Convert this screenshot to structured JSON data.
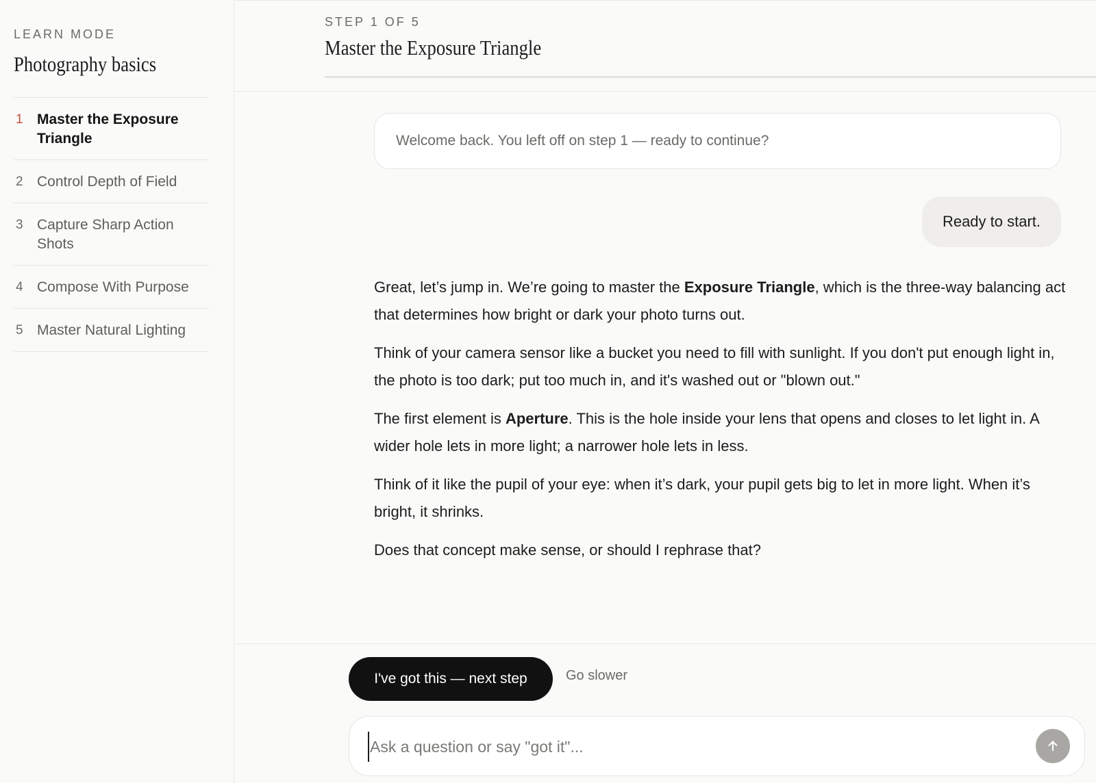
{
  "sidebar": {
    "mode_label": "LEARN MODE",
    "course_title": "Photography basics",
    "steps": [
      {
        "num": "1",
        "label": "Master the Exposure Triangle",
        "active": true
      },
      {
        "num": "2",
        "label": "Control Depth of Field"
      },
      {
        "num": "3",
        "label": "Capture Sharp Action Shots"
      },
      {
        "num": "4",
        "label": "Compose With Purpose"
      },
      {
        "num": "5",
        "label": "Master Natural Lighting"
      }
    ]
  },
  "header": {
    "step_indicator": "STEP 1 OF 5",
    "title": "Master the Exposure Triangle"
  },
  "chat": {
    "welcome": "Welcome back. You left off on step 1 — ready to continue?",
    "user_message": "Ready to start.",
    "assistant": {
      "p1_before": "Great, let’s jump in. We’re going to master the ",
      "p1_bold": "Exposure Triangle",
      "p1_after": ", which is the three-way balancing act that determines how bright or dark your photo turns out.",
      "p2": "Think of your camera sensor like a bucket you need to fill with sunlight. If you don't put enough light in, the photo is too dark; put too much in, and it's washed out or \"blown out.\"",
      "p3_before": "The first element is ",
      "p3_bold": "Aperture",
      "p3_after": ". This is the hole inside your lens that opens and closes to let light in. A wider hole lets in more light; a narrower hole lets in less.",
      "p4": "Think of it like the pupil of your eye: when it’s dark, your pupil gets big to let in more light. When it’s bright, it shrinks.",
      "p5": "Does that concept make sense, or should I rephrase that?"
    }
  },
  "actions": {
    "next_label": "I've got this — next step",
    "slower_label": "Go slower"
  },
  "composer": {
    "placeholder": "Ask a question or say \"got it\"...",
    "send_icon": "arrow-up-icon"
  },
  "colors": {
    "accent_step_number": "#c4513b",
    "primary_button": "#111111",
    "send_button": "#a8a7a4"
  }
}
